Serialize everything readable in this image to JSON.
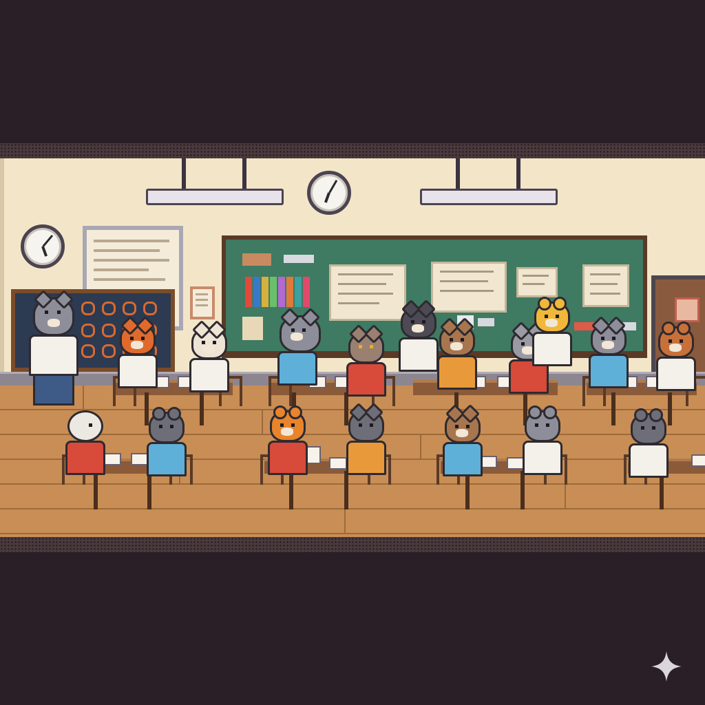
{
  "scene": {
    "type": "pixel-art classroom",
    "colors": {
      "wall": "#f3e6c8",
      "floor": "#c98e55",
      "blackboard": "#3f7a62",
      "letterbox": "#2a1e27"
    }
  },
  "wall_clocks": [
    {
      "name": "clock-center",
      "hour_angle": 200,
      "minute_angle": 30
    },
    {
      "name": "clock-left",
      "hour_angle": 160,
      "minute_angle": 40
    }
  ],
  "icons": {
    "watermark": "sparkle-icon",
    "door_sign": "recycle-icon"
  }
}
